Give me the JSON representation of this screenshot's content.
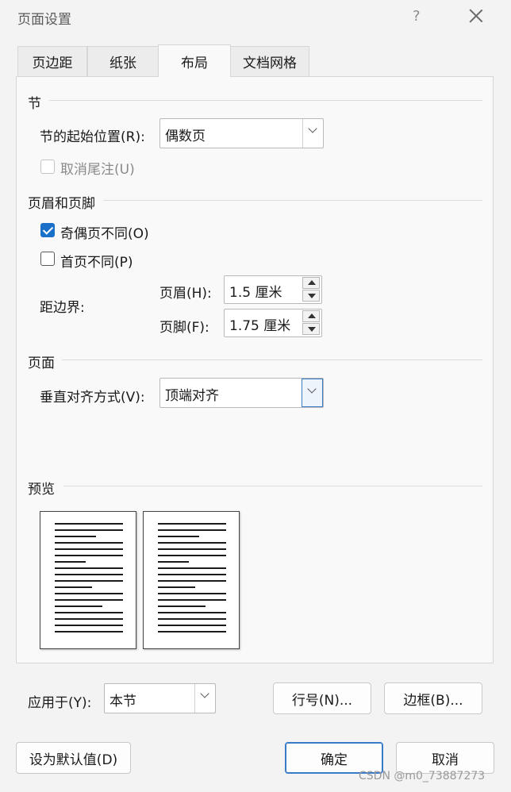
{
  "window": {
    "title": "页面设置",
    "help_label": "?"
  },
  "tabs": [
    {
      "label": "页边距",
      "active": false
    },
    {
      "label": "纸张",
      "active": false
    },
    {
      "label": "布局",
      "active": true
    },
    {
      "label": "文档网格",
      "active": false
    }
  ],
  "section_start": {
    "heading": "节",
    "start_label": "节的起始位置(R):",
    "start_value": "偶数页",
    "suppress_endnotes_label": "取消尾注(U)",
    "suppress_endnotes_checked": false
  },
  "header_footer": {
    "heading": "页眉和页脚",
    "odd_even_label": "奇偶页不同(O)",
    "odd_even_checked": true,
    "first_page_label": "首页不同(P)",
    "first_page_checked": false,
    "from_edge_label": "距边界:",
    "header_label": "页眉(H):",
    "header_value": "1.5 厘米",
    "footer_label": "页脚(F):",
    "footer_value": "1.75 厘米"
  },
  "page": {
    "heading": "页面",
    "valign_label": "垂直对齐方式(V):",
    "valign_value": "顶端对齐"
  },
  "preview": {
    "heading": "预览"
  },
  "apply": {
    "label": "应用于(Y):",
    "value": "本节"
  },
  "buttons": {
    "line_numbers": "行号(N)...",
    "borders": "边框(B)...",
    "set_default": "设为默认值(D)",
    "ok": "确定",
    "cancel": "取消"
  },
  "watermark": "CSDN @m0_73887273"
}
